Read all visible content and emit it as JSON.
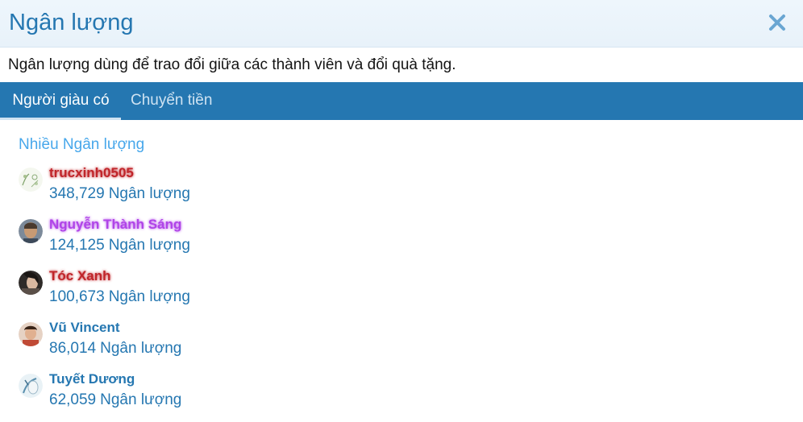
{
  "dialog": {
    "title": "Ngân lượng",
    "description": "Ngân lượng dùng để trao đổi giữa các thành viên và đổi quà tặng.",
    "close_icon": "close-icon"
  },
  "tabs": [
    {
      "label": "Người giàu có",
      "active": true
    },
    {
      "label": "Chuyển tiền",
      "active": false
    }
  ],
  "section": {
    "heading": "Nhiều Ngân lượng"
  },
  "currency_label": "Ngân lượng",
  "users": [
    {
      "name": "trucxinh0505",
      "amount": "348,729",
      "name_color": "#c0252a",
      "glow": true
    },
    {
      "name": "Nguyễn Thành Sáng",
      "amount": "124,125",
      "name_color": "#b044e8",
      "glow": true
    },
    {
      "name": "Tóc Xanh",
      "amount": "100,673",
      "name_color": "#c0252a",
      "glow": true
    },
    {
      "name": "Vũ Vincent",
      "amount": "86,014",
      "name_color": "#2577b1",
      "glow": false
    },
    {
      "name": "Tuyết Dương",
      "amount": "62,059",
      "name_color": "#2577b1",
      "glow": false
    }
  ],
  "colors": {
    "accent": "#2577b1",
    "tab_bar": "#2577b1",
    "link_light": "#47a7eb"
  }
}
